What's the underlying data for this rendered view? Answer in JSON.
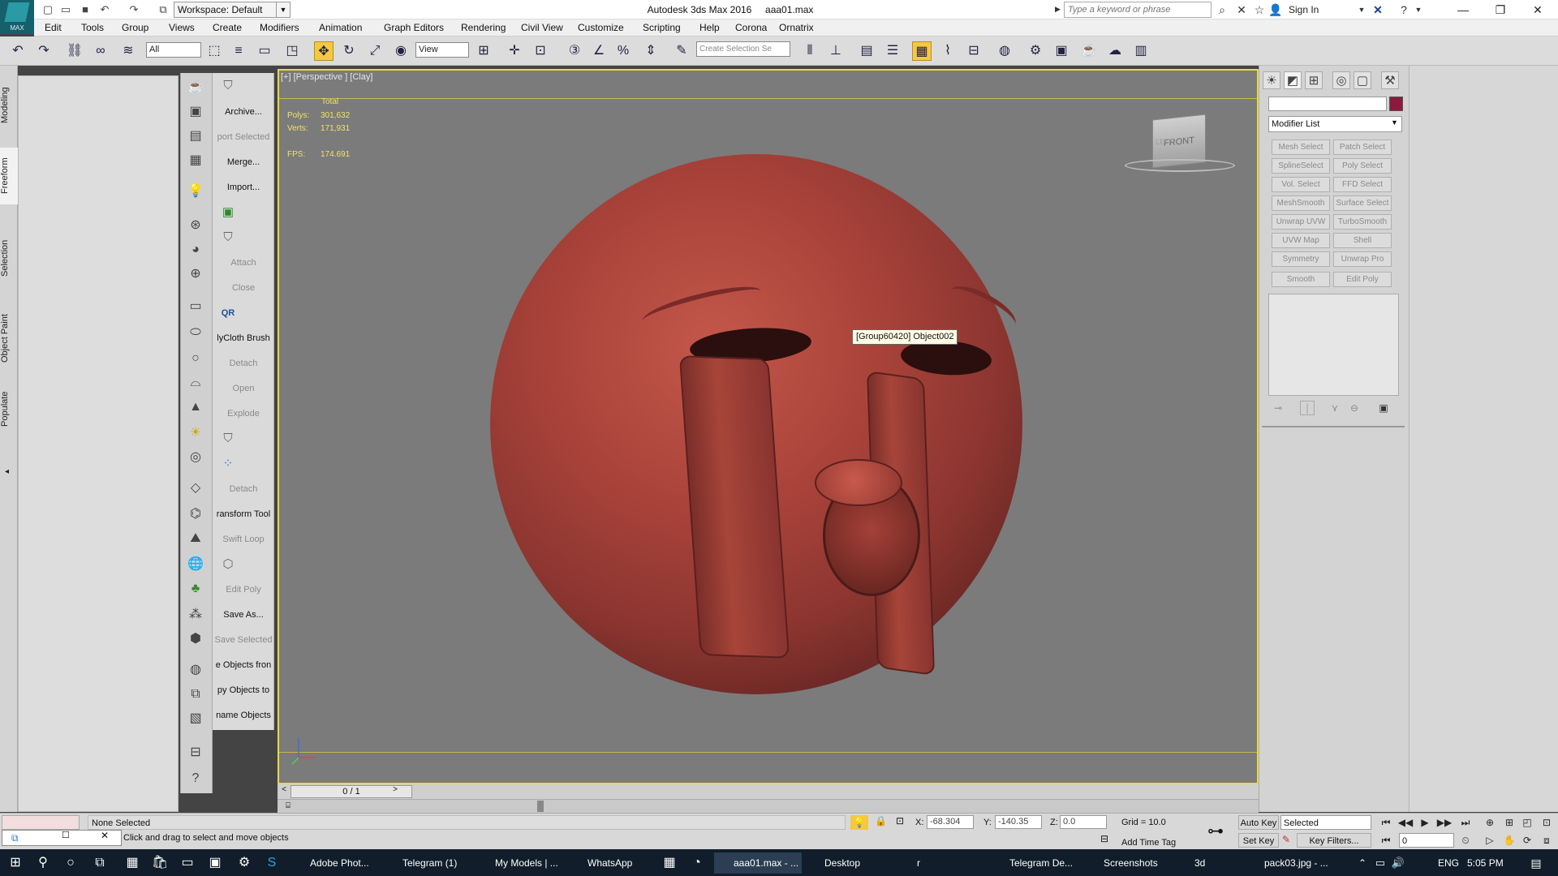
{
  "app": {
    "window_title": "Autodesk 3ds Max 2016",
    "file_name": "aaa01.max",
    "logo_text": "MAX",
    "workspace": "Workspace: Default"
  },
  "infocenter": {
    "search_placeholder": "Type a keyword or phrase",
    "sign_in": "Sign In"
  },
  "menu": [
    "Edit",
    "Tools",
    "Group",
    "Views",
    "Create",
    "Modifiers",
    "Animation",
    "Graph Editors",
    "Rendering",
    "Civil View",
    "Customize",
    "Scripting",
    "Help",
    "Corona",
    "Ornatrix"
  ],
  "toolbar": {
    "selection_filter": "All",
    "ref_coord": "View",
    "selection_set_placeholder": "Create Selection Se"
  },
  "left_tabs": [
    "Modeling",
    "Freeform",
    "Selection",
    "Object Paint",
    "Populate"
  ],
  "tool_labels": [
    {
      "label": "Archive...",
      "dim": false
    },
    {
      "label": "port Selected",
      "dim": true
    },
    {
      "label": "Merge...",
      "dim": false
    },
    {
      "label": "Import...",
      "dim": false
    },
    {
      "label": "Attach",
      "dim": true
    },
    {
      "label": "Close",
      "dim": true
    },
    {
      "label": "lyCloth Brush",
      "dim": false
    },
    {
      "label": "Detach",
      "dim": true
    },
    {
      "label": "Open",
      "dim": true
    },
    {
      "label": "Explode",
      "dim": true
    },
    {
      "label": "Detach",
      "dim": true
    },
    {
      "label": "ransform Tool",
      "dim": false
    },
    {
      "label": "Swift Loop",
      "dim": true
    },
    {
      "label": "Edit Poly",
      "dim": true
    },
    {
      "label": "Save As...",
      "dim": false
    },
    {
      "label": "Save Selected",
      "dim": true
    },
    {
      "label": "e Objects fron",
      "dim": false
    },
    {
      "label": "py Objects to",
      "dim": false
    },
    {
      "label": "name Objects",
      "dim": false
    }
  ],
  "viewport": {
    "label": "[+] [Perspective ] [Clay]",
    "stats_header": "Total",
    "polys_label": "Polys:",
    "polys": "301,632",
    "verts_label": "Verts:",
    "verts": "171,931",
    "fps_label": "FPS:",
    "fps": "174.691",
    "tooltip": "[Group60420] Object002",
    "viewcube_face": "FRONT",
    "viewcube_side": "LEFT"
  },
  "command_panel": {
    "modifier_list": "Modifier List",
    "modifier_buttons": [
      "Mesh Select",
      "Patch Select",
      "SplineSelect",
      "Poly Select",
      "Vol. Select",
      "FFD Select",
      "MeshSmooth",
      "Surface Select",
      "Unwrap UVW",
      "TurboSmooth",
      "UVW Map",
      "Shell",
      "Symmetry",
      "Unwrap Pro",
      "Smooth",
      "Edit Poly"
    ],
    "object_color": "#8c1a3f"
  },
  "timeline": {
    "frame": "0 / 1"
  },
  "status": {
    "selection": "None Selected",
    "prompt": "Click and drag to select and move objects",
    "x_label": "X:",
    "x": "-68.304",
    "y_label": "Y:",
    "y": "-140.35",
    "z_label": "Z:",
    "z": "0.0",
    "grid": "Grid = 10.0",
    "add_time_tag": "Add Time Tag",
    "auto_key": "Auto Key",
    "set_key": "Set Key",
    "key_mode": "Selected",
    "key_filters": "Key Filters...",
    "current_frame": "0"
  },
  "taskbar": {
    "items": [
      "Adobe Phot...",
      "Telegram (1)",
      "My Models | ...",
      "WhatsApp",
      "aaa01.max - ...",
      "Desktop",
      "r",
      "Telegram De...",
      "Screenshots",
      "3d",
      "pack03.jpg - ..."
    ],
    "language": "ENG",
    "time": "5:05 PM"
  }
}
